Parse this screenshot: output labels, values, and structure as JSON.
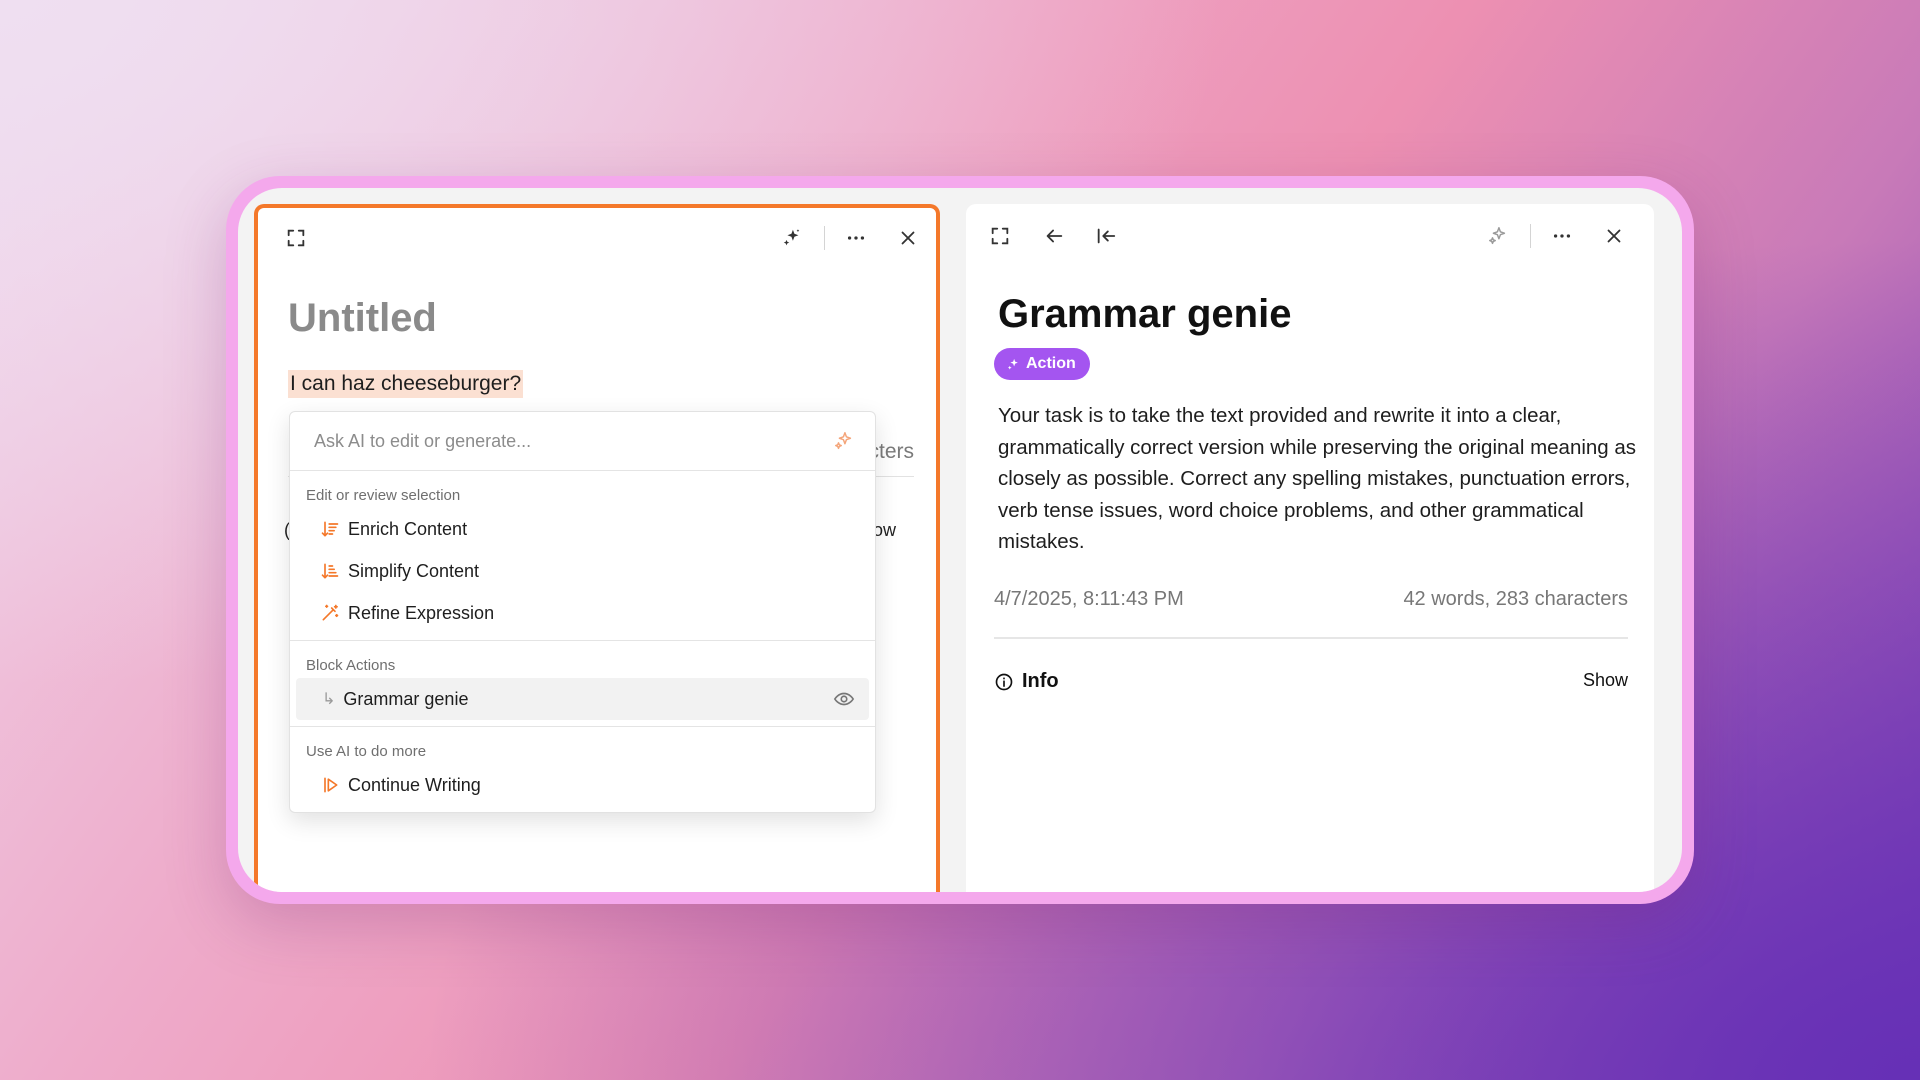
{
  "editor": {
    "title": "Untitled",
    "highlighted_text": "I can haz cheeseburger?",
    "behind_chars_fragment": "cters",
    "behind_show_fragment": "ow",
    "behind_left_fragment": "("
  },
  "ai_menu": {
    "placeholder": "Ask AI to edit or generate...",
    "sections": {
      "edit": {
        "label": "Edit or review selection",
        "items": [
          "Enrich Content",
          "Simplify Content",
          "Refine Expression"
        ]
      },
      "block": {
        "label": "Block Actions",
        "items": [
          "Grammar genie"
        ]
      },
      "more": {
        "label": "Use AI to do more",
        "items": [
          "Continue Writing"
        ]
      }
    }
  },
  "detail": {
    "title": "Grammar genie",
    "badge": "Action",
    "description": "Your task is to take the text provided and rewrite it into a clear, grammatically correct version while preserving the original meaning as closely as possible. Correct any spelling mistakes, punctuation errors, verb tense issues, word choice problems, and other grammatical mistakes.",
    "date": "4/7/2025, 8:11:43 PM",
    "count": "42 words, 283 characters",
    "info_label": "Info",
    "show_label": "Show"
  },
  "colors": {
    "accent_orange": "#f4782a",
    "badge_purple": "#a455f0",
    "highlight": "#fbe0d2"
  }
}
